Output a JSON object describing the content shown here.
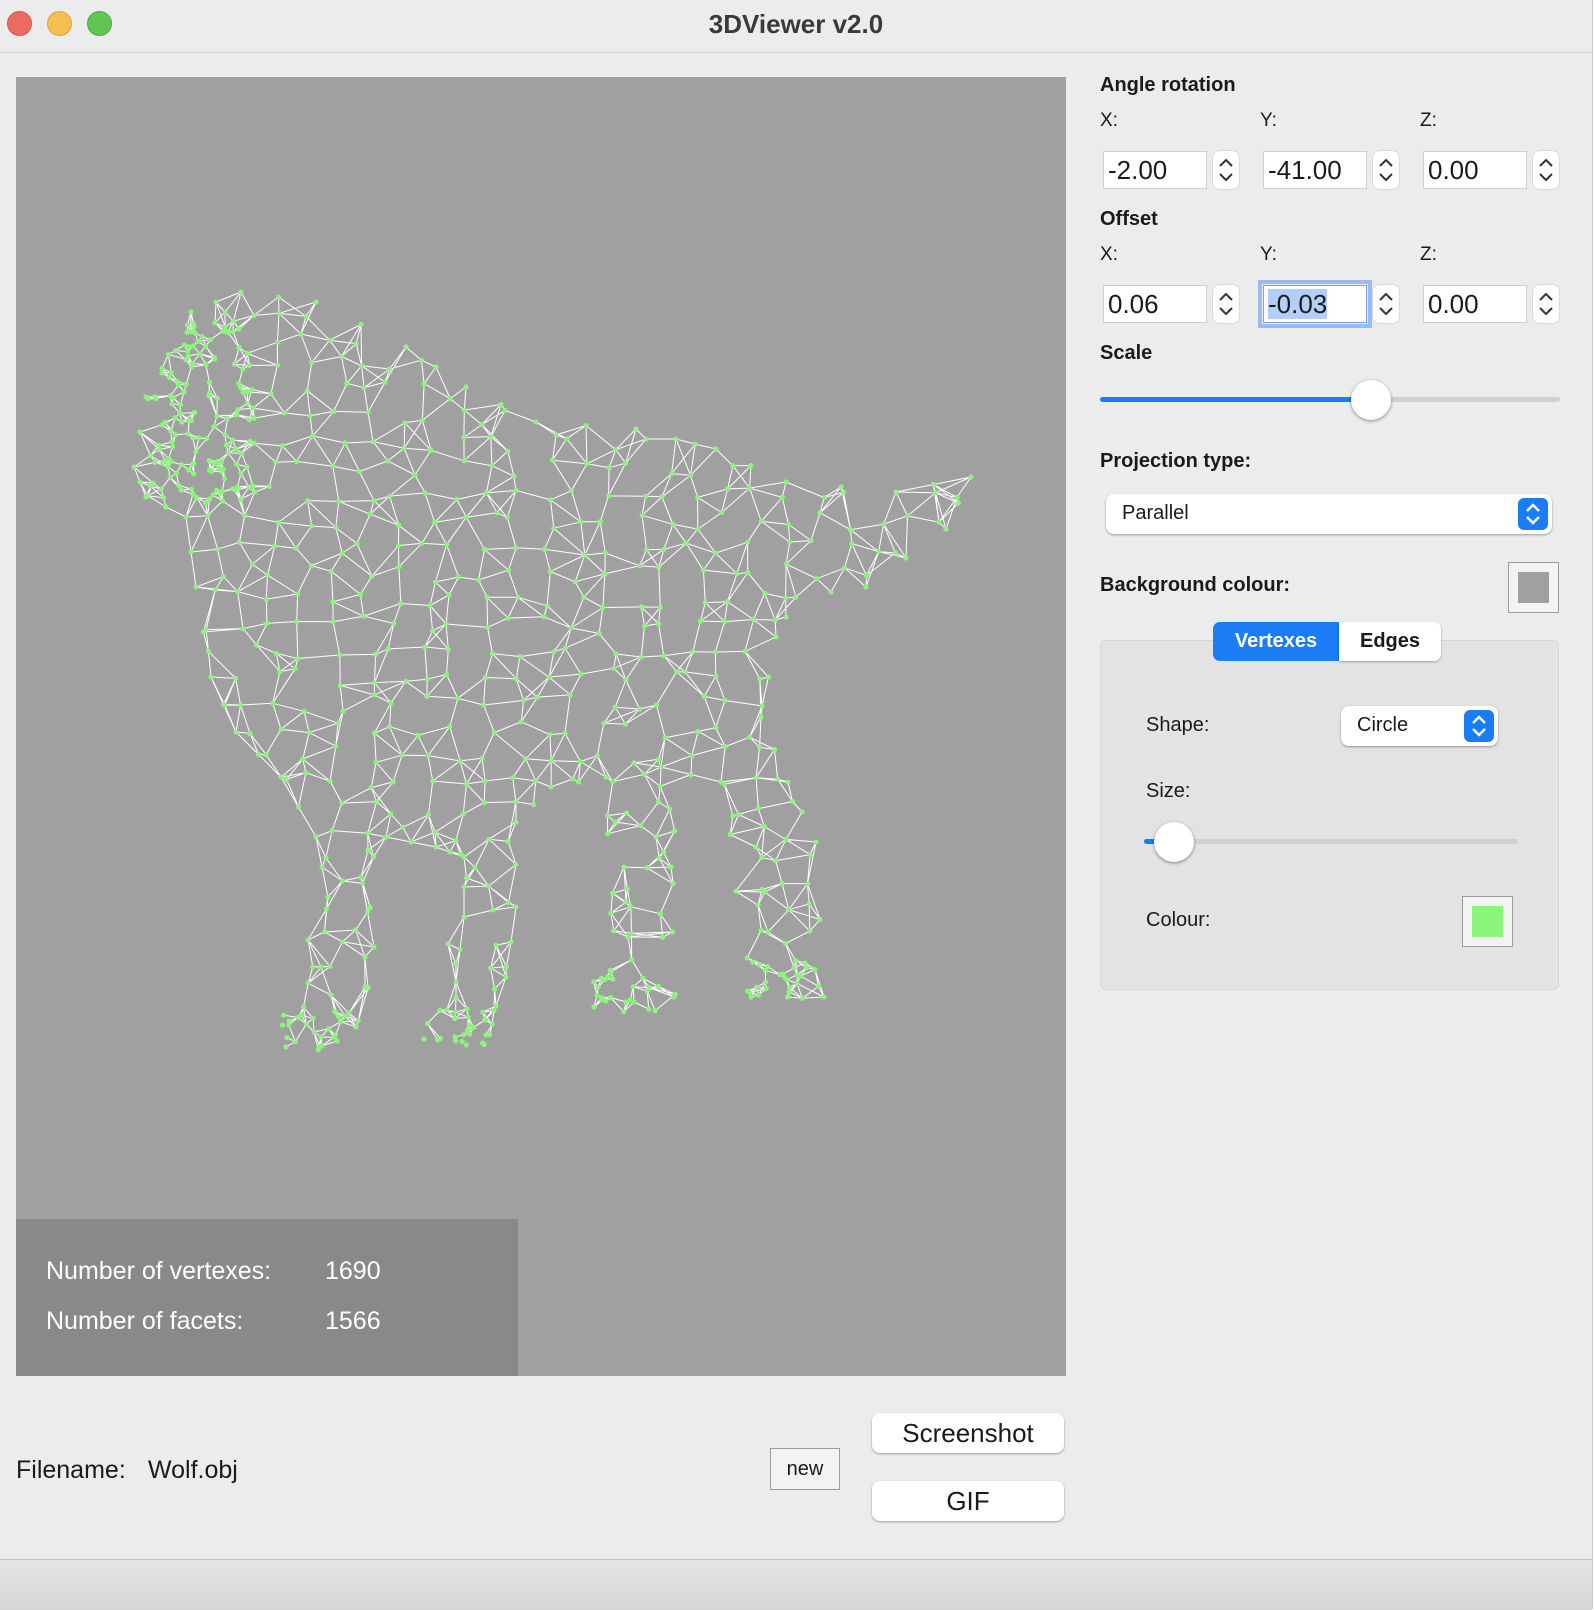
{
  "window": {
    "title": "3DViewer v2.0"
  },
  "viewport": {
    "background": "#a0a0a0",
    "vertex_color": "#8cf57c",
    "edge_color": "#ffffff",
    "stats": {
      "vertexes_label": "Number of vertexes:",
      "vertexes_value": "1690",
      "facets_label": "Number of facets:",
      "facets_value": "1566"
    }
  },
  "file": {
    "label": "Filename:",
    "value": "Wolf.obj"
  },
  "buttons": {
    "new": "new",
    "screenshot": "Screenshot",
    "gif": "GIF"
  },
  "angle_rotation": {
    "title": "Angle rotation",
    "x_label": "X:",
    "y_label": "Y:",
    "z_label": "Z:",
    "x": "-2.00",
    "y": "-41.00",
    "z": "0.00"
  },
  "offset": {
    "title": "Offset",
    "x_label": "X:",
    "y_label": "Y:",
    "z_label": "Z:",
    "x": "0.06",
    "y": "-0.03",
    "z": "0.00"
  },
  "scale": {
    "title": "Scale",
    "value_fraction": 0.59
  },
  "projection": {
    "title": "Projection type:",
    "value": "Parallel"
  },
  "background_colour": {
    "title": "Background colour:",
    "color": "#a0a0a0"
  },
  "tabs": {
    "vertexes": "Vertexes",
    "edges": "Edges",
    "active": "vertexes"
  },
  "vertex_settings": {
    "shape_label": "Shape:",
    "shape_value": "Circle",
    "size_label": "Size:",
    "size_fraction": 0.08,
    "colour_label": "Colour:",
    "colour": "#8cf57c"
  },
  "icons": {
    "close": "close-icon",
    "minimize": "minimize-icon",
    "maximize": "maximize-icon",
    "stepper": "stepper-arrows-icon",
    "select_arrows": "select-arrows-icon"
  }
}
